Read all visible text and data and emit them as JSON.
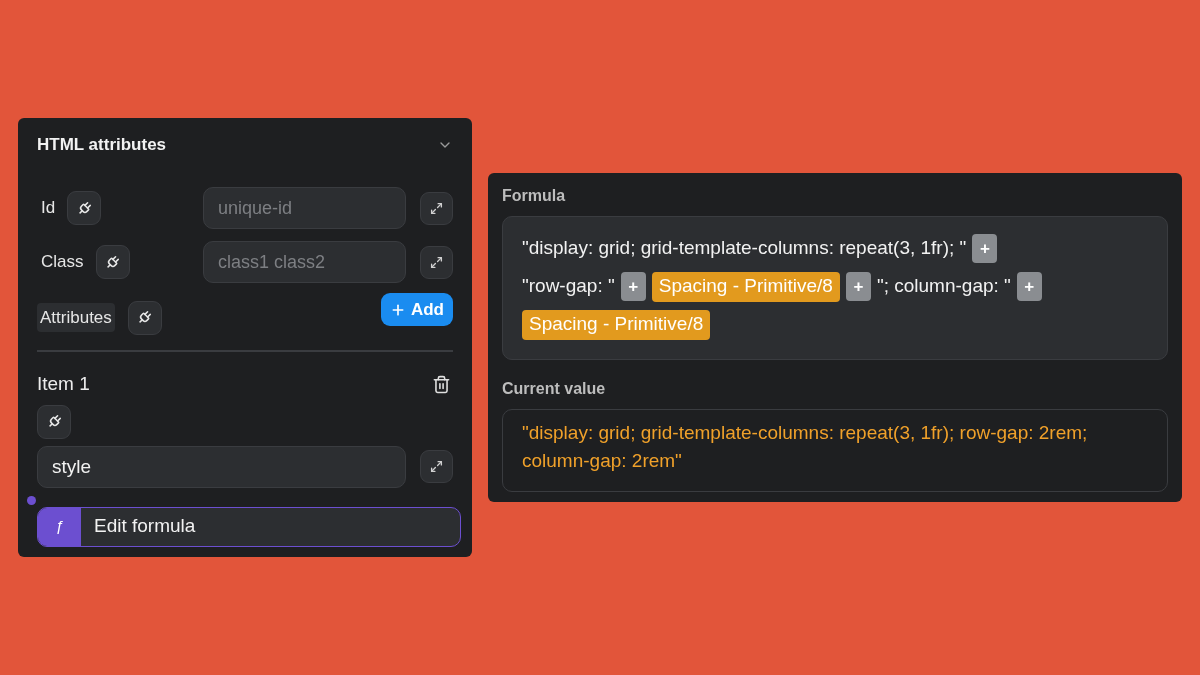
{
  "panel": {
    "title": "HTML attributes",
    "expanded": true,
    "fields": [
      {
        "label": "Id",
        "placeholder": "unique-id"
      },
      {
        "label": "Class",
        "placeholder": "class1 class2"
      }
    ],
    "attributes_label": "Attributes",
    "add_button": "Add",
    "item": {
      "title": "Item 1",
      "name_value": "style",
      "formula_icon": "ƒ",
      "formula_button": "Edit formula",
      "formula_active": true
    }
  },
  "formula": {
    "label": "Formula",
    "lines": [
      [
        {
          "kind": "text",
          "text": "\"display: grid; grid-template-columns: repeat(3, 1fr); \""
        },
        {
          "kind": "plus",
          "text": "+"
        }
      ],
      [
        {
          "kind": "text",
          "text": "\"row-gap: \""
        },
        {
          "kind": "plus",
          "text": "+"
        },
        {
          "kind": "variable",
          "text": "Spacing - Primitive/8"
        },
        {
          "kind": "plus",
          "text": "+"
        },
        {
          "kind": "text",
          "text": "\"; column-gap: \""
        },
        {
          "kind": "plus",
          "text": "+"
        }
      ],
      [
        {
          "kind": "variable",
          "text": "Spacing - Primitive/8"
        }
      ]
    ]
  },
  "current_value": {
    "label": "Current value",
    "value": "\"display: grid; grid-template-columns: repeat(3, 1fr); row-gap: 2rem; column-gap: 2rem\""
  }
}
